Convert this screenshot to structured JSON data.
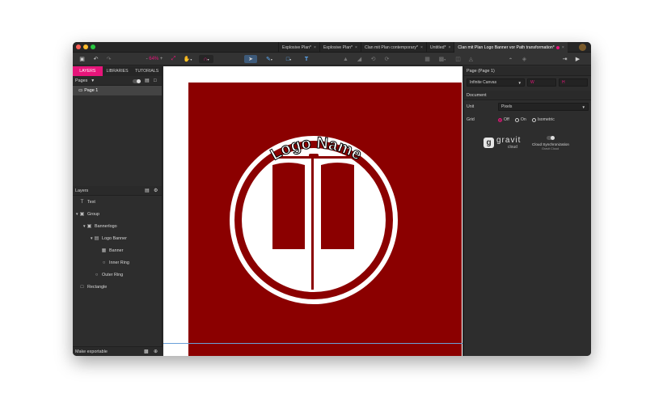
{
  "tabs": [
    {
      "label": "Explosive Plan*",
      "active": false
    },
    {
      "label": "Explosive Plan*",
      "active": false
    },
    {
      "label": "Clan mit Plan contemporary*",
      "active": false
    },
    {
      "label": "Untitled*",
      "active": false
    },
    {
      "label": "Clan mit Plan Logo Banner vor Path transformation*",
      "active": true
    }
  ],
  "toolbar": {
    "zoom": "64%"
  },
  "left_panel": {
    "tabs": [
      "LAYERS",
      "LIBRARIES",
      "TUTORIALS"
    ],
    "pages_label": "Pages",
    "page_item": "Page 1",
    "layers_label": "Layers",
    "layers": [
      {
        "label": "Text",
        "icon": "text-icon",
        "indent": 0,
        "caret": false
      },
      {
        "label": "Group",
        "icon": "group-icon",
        "indent": 0,
        "caret": true
      },
      {
        "label": "Bannerlogo",
        "icon": "group-icon",
        "indent": 1,
        "caret": true
      },
      {
        "label": "Logo Banner",
        "icon": "symbol-icon",
        "indent": 2,
        "caret": true
      },
      {
        "label": "Banner",
        "icon": "path-icon",
        "indent": 3,
        "caret": false
      },
      {
        "label": "Inner Ring",
        "icon": "ellipse-icon",
        "indent": 3,
        "caret": false
      },
      {
        "label": "Outer Ring",
        "icon": "ellipse-icon",
        "indent": 2,
        "caret": false
      },
      {
        "label": "Rectangle",
        "icon": "rectangle-icon",
        "indent": 0,
        "caret": false
      }
    ],
    "export_label": "Make exportable"
  },
  "canvas": {
    "logo_text": "Logo Name",
    "artboard_color": "#8b0000"
  },
  "right_panel": {
    "page_header": "Page (Page 1)",
    "canvas_select": "Infinite Canvas",
    "w_placeholder": "W",
    "h_placeholder": "H",
    "document_header": "Document",
    "unit_label": "Unit",
    "unit_value": "Pixels",
    "grid_label": "Grid",
    "grid_options": [
      "Off",
      "On",
      "Isometric"
    ],
    "gravit_brand": "gravit",
    "gravit_sub": "cloud",
    "cloud_title": "Cloud Synchronization",
    "cloud_sub": "Gravit Cloud"
  },
  "colors": {
    "accent": "#e6157a",
    "panel": "#2d2d2d",
    "logo_red": "#8b0000"
  }
}
